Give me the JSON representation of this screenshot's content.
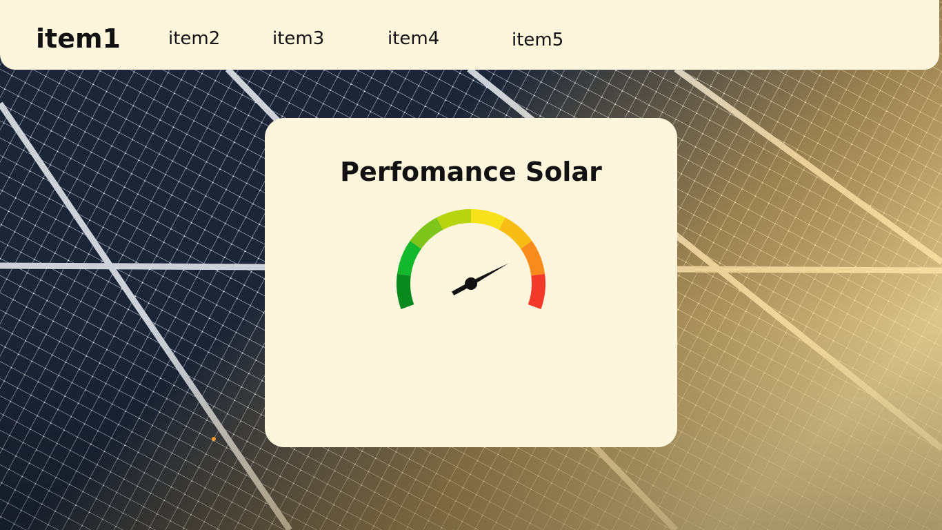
{
  "nav": {
    "items": [
      "item1",
      "item2",
      "item3",
      "item4",
      "item5"
    ]
  },
  "card": {
    "title": "Perfomance Solar"
  },
  "gauge": {
    "value_fraction": 0.78,
    "segment_colors": [
      "#0a8a1e",
      "#14b82c",
      "#7fc41a",
      "#b8d40e",
      "#f6e11a",
      "#f7bd14",
      "#f98b1c",
      "#f3392a"
    ]
  },
  "colors": {
    "panel_background": "#fdf6dc",
    "text": "#111111"
  }
}
